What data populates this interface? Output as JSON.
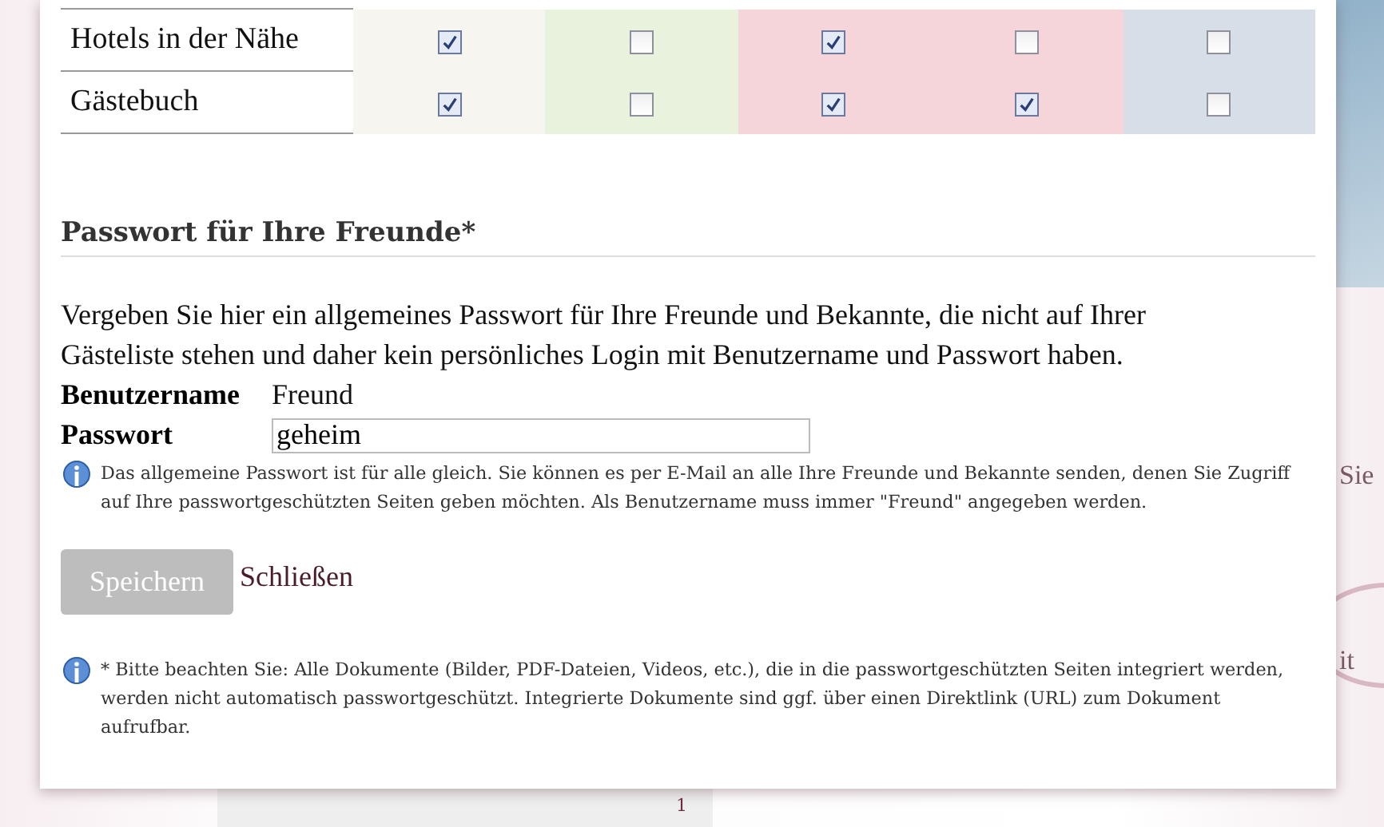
{
  "background": {
    "text_1": "Sie",
    "text_2": "it",
    "page_number": "1"
  },
  "permissions": {
    "columns": [
      {
        "color": "#f6f5f0"
      },
      {
        "color": "#e8f2dc"
      },
      {
        "color": "#f5d5d9"
      },
      {
        "color": "#f5d5d9"
      },
      {
        "color": "#d8dee8"
      }
    ],
    "rows": [
      {
        "label": "Hotels in der Nähe",
        "checks": [
          true,
          false,
          true,
          false,
          false
        ]
      },
      {
        "label": "Gästebuch",
        "checks": [
          true,
          false,
          true,
          true,
          false
        ]
      }
    ]
  },
  "friends_password": {
    "heading": "Passwort für Ihre Freunde*",
    "description": "Vergeben Sie hier ein allgemeines Passwort für Ihre Freunde und Bekannte, die nicht auf Ihrer Gästeliste stehen und daher kein persönliches Login mit Benutzername und Passwort haben.",
    "username_label": "Benutzername",
    "username_value": "Freund",
    "password_label": "Passwort",
    "password_value": "geheim",
    "info": "Das allgemeine Passwort ist für alle gleich. Sie können es per E-Mail an alle Ihre Freunde und Bekannte senden, denen Sie Zugriff auf Ihre passwortgeschützten Seiten geben möchten. Als Benutzername muss immer \"Freund\" angegeben werden."
  },
  "buttons": {
    "save": {
      "label": "Speichern",
      "disabled": true
    },
    "close": "Schließen"
  },
  "footnote": "* Bitte beachten Sie: Alle Dokumente (Bilder, PDF-Dateien, Videos, etc.), die in die passwortgeschützten Seiten integriert werden, werden nicht automatisch passwortgeschützt. Integrierte Dokumente sind ggf. über einen Direktlink (URL) zum Dokument aufrufbar."
}
